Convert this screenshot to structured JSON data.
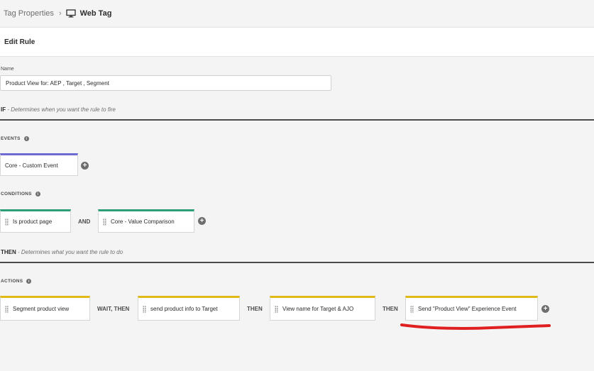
{
  "breadcrumb": {
    "parent": "Tag Properties",
    "separator": "›",
    "current": "Web Tag",
    "current_icon": "monitor-icon"
  },
  "header": {
    "title": "Edit Rule"
  },
  "name_field": {
    "label": "Name",
    "value": "Product View for: AEP , Target , Segment"
  },
  "if_section": {
    "keyword": "IF",
    "description": " - Determines when you want the rule to fire"
  },
  "events": {
    "label": "EVENTS",
    "items": [
      {
        "label": "Core - Custom Event"
      }
    ]
  },
  "conditions": {
    "label": "CONDITIONS",
    "items": [
      {
        "label": "Is product page"
      },
      {
        "label": "Core - Value Comparison"
      }
    ],
    "joiner": "AND"
  },
  "then_section": {
    "keyword": "THEN",
    "description": " - Determines what you want the rule to do"
  },
  "actions": {
    "label": "ACTIONS",
    "items": [
      {
        "label": "Segment product view"
      },
      {
        "label": "send product info to Target"
      },
      {
        "label": "View name for Target & AJO"
      },
      {
        "label": "Send \"Product View\" Experience Event"
      }
    ],
    "connectors": [
      "WAIT, THEN",
      "THEN",
      "THEN"
    ]
  },
  "colors": {
    "event_accent": "#6e6ad4",
    "condition_accent": "#2d9d78",
    "action_accent": "#e0bb18",
    "annotation": "#e02020"
  }
}
